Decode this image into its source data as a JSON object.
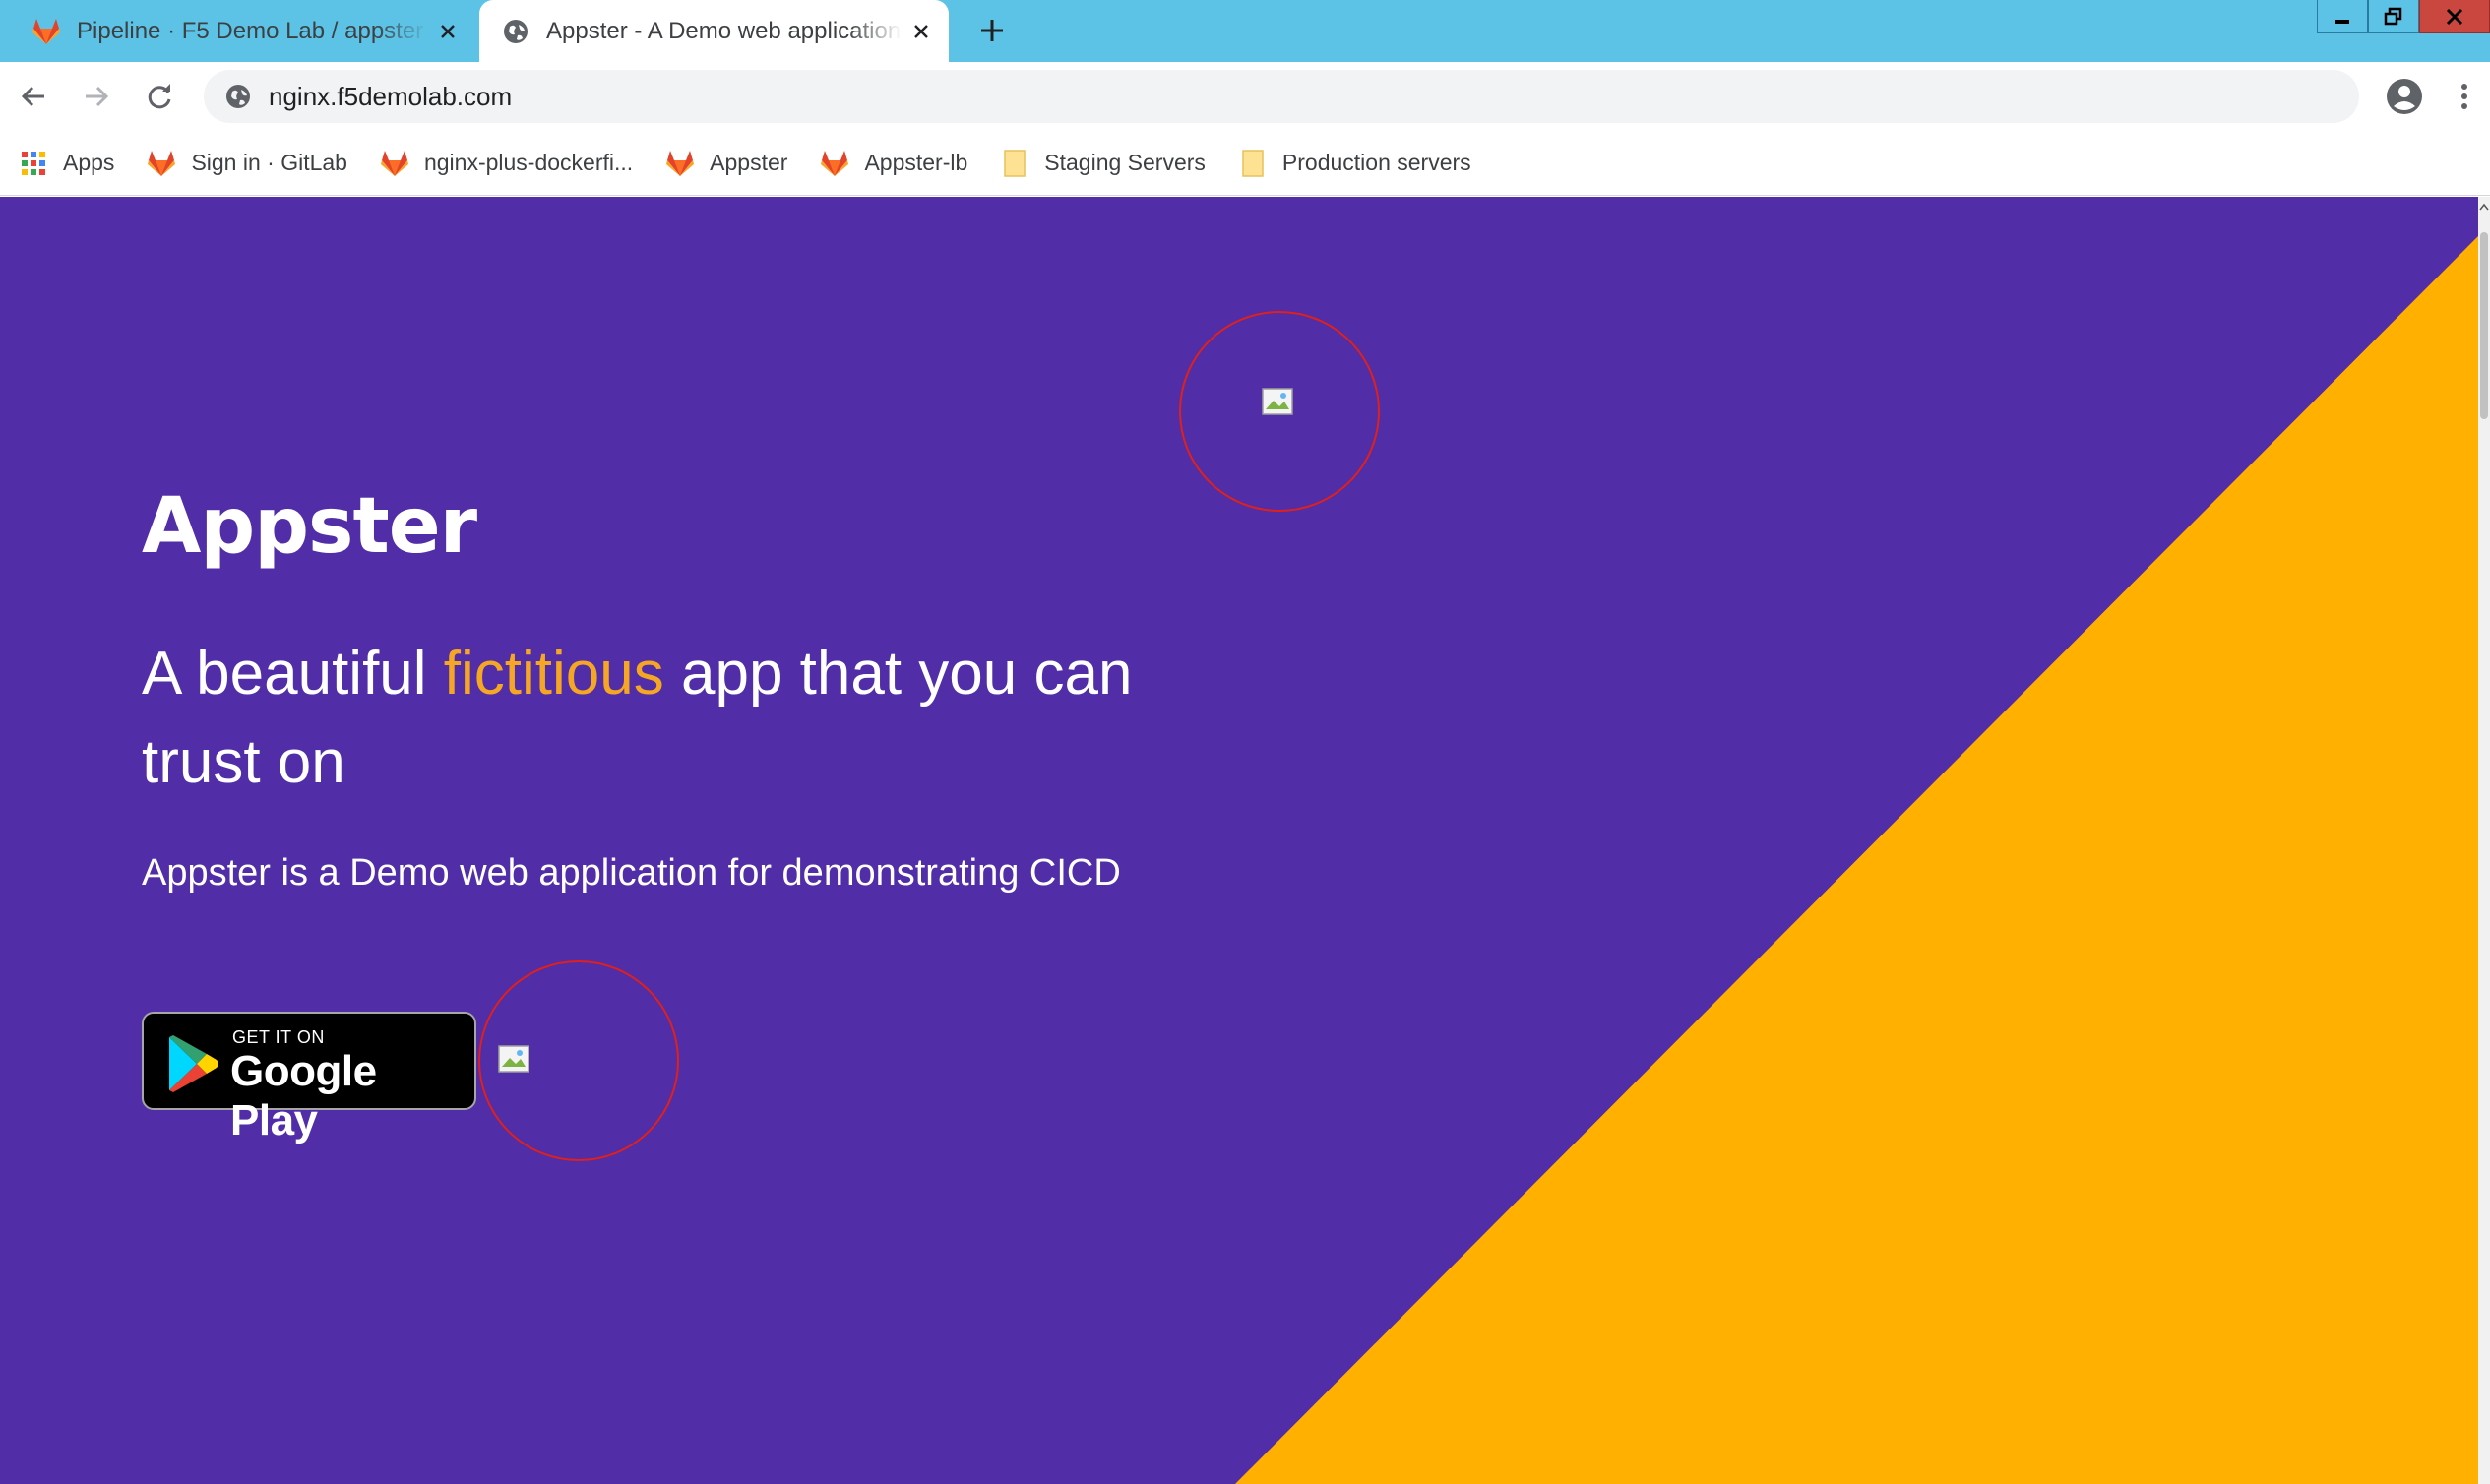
{
  "browser": {
    "tabs": [
      {
        "title": "Pipeline · F5 Demo Lab / appster",
        "icon": "gitlab-icon",
        "active": false
      },
      {
        "title": "Appster - A Demo web application",
        "icon": "globe-icon",
        "active": true
      }
    ],
    "address_bar": {
      "url": "nginx.f5demolab.com"
    },
    "bookmarks": [
      {
        "label": "Apps",
        "icon": "apps-grid-icon"
      },
      {
        "label": "Sign in · GitLab",
        "icon": "gitlab-icon"
      },
      {
        "label": "nginx-plus-dockerfi...",
        "icon": "gitlab-icon"
      },
      {
        "label": "Appster",
        "icon": "gitlab-icon"
      },
      {
        "label": "Appster-lb",
        "icon": "gitlab-icon"
      },
      {
        "label": "Staging Servers",
        "icon": "folder-icon"
      },
      {
        "label": "Production servers",
        "icon": "folder-icon"
      }
    ]
  },
  "page": {
    "title": "Appster",
    "tagline_before": "A beautiful ",
    "tagline_accent": "fictitious",
    "tagline_after": " app that you can trust on",
    "description": "Appster is a Demo web application for demonstrating CICD",
    "play_badge": {
      "small": "GET IT ON",
      "large": "Google Play"
    }
  },
  "colors": {
    "background": "#512da8",
    "triangle": "#ffb000",
    "accent_text": "#f5a623",
    "tab_strip": "#5dc3e6",
    "annotation_circle": "#e0201a"
  }
}
